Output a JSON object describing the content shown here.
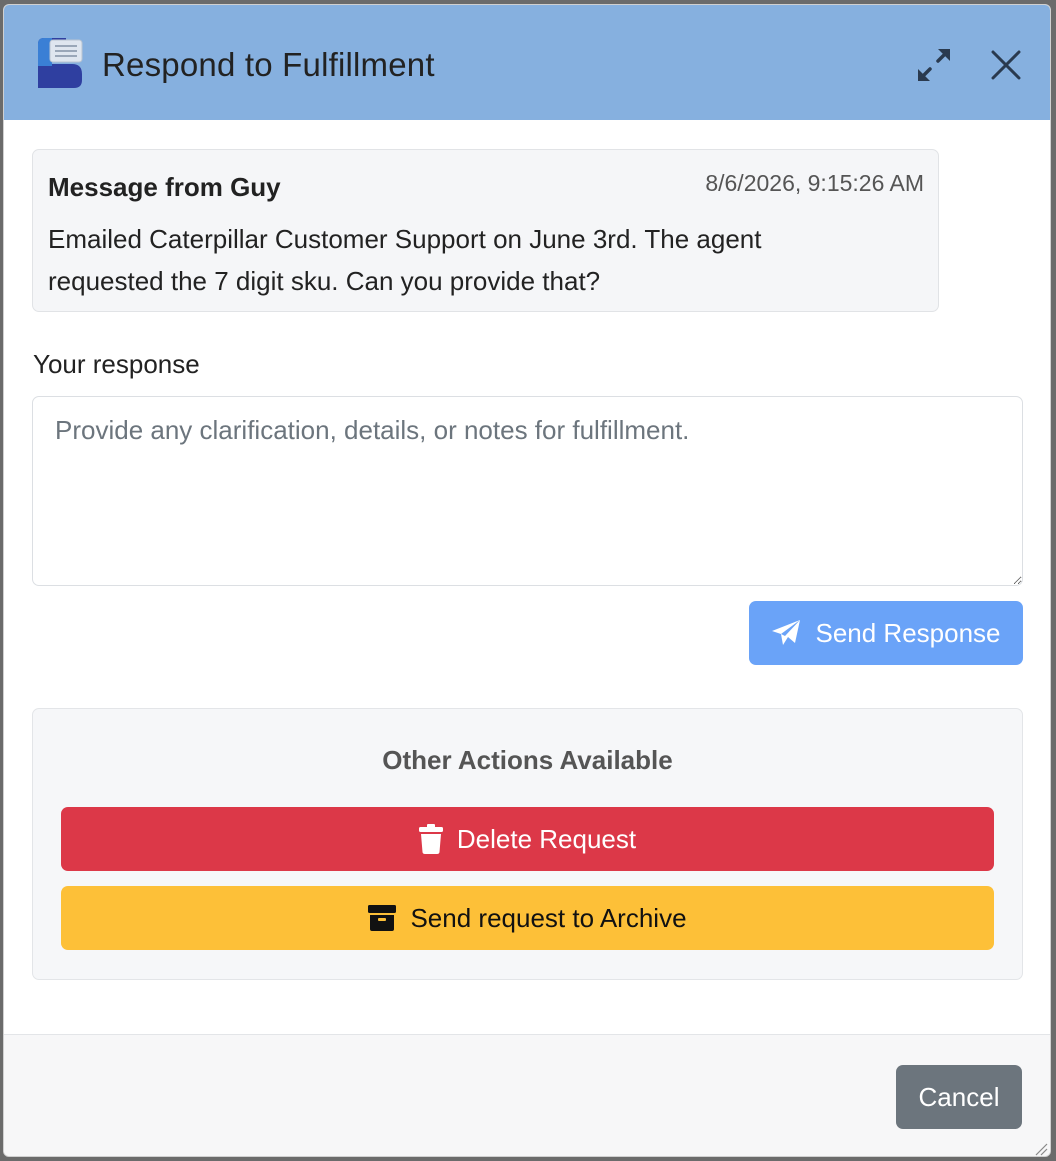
{
  "dialog": {
    "title": "Respond to Fulfillment",
    "icons": {
      "logo": "app-logo",
      "expand": "expand-icon",
      "close": "close-icon"
    }
  },
  "message": {
    "from": "Message from Guy",
    "timestamp": "8/6/2026, 9:15:26 AM",
    "body": "Emailed Caterpillar Customer Support on June 3rd. The agent requested the 7 digit sku. Can you provide that?"
  },
  "response": {
    "label": "Your response",
    "value": "",
    "placeholder": "Provide any clarification, details, or notes for fulfillment.",
    "send_label": "Send Response",
    "send_icon": "paper-plane-icon"
  },
  "other_actions": {
    "title": "Other Actions Available",
    "delete_label": "Delete Request",
    "delete_icon": "trash-icon",
    "archive_label": "Send request to Archive",
    "archive_icon": "archive-box-icon"
  },
  "footer": {
    "cancel_label": "Cancel"
  },
  "colors": {
    "titlebar": "#86b0df",
    "primary": "#6aa3f8",
    "danger": "#dc3848",
    "warning": "#fdc038",
    "secondary": "#6c757d"
  }
}
